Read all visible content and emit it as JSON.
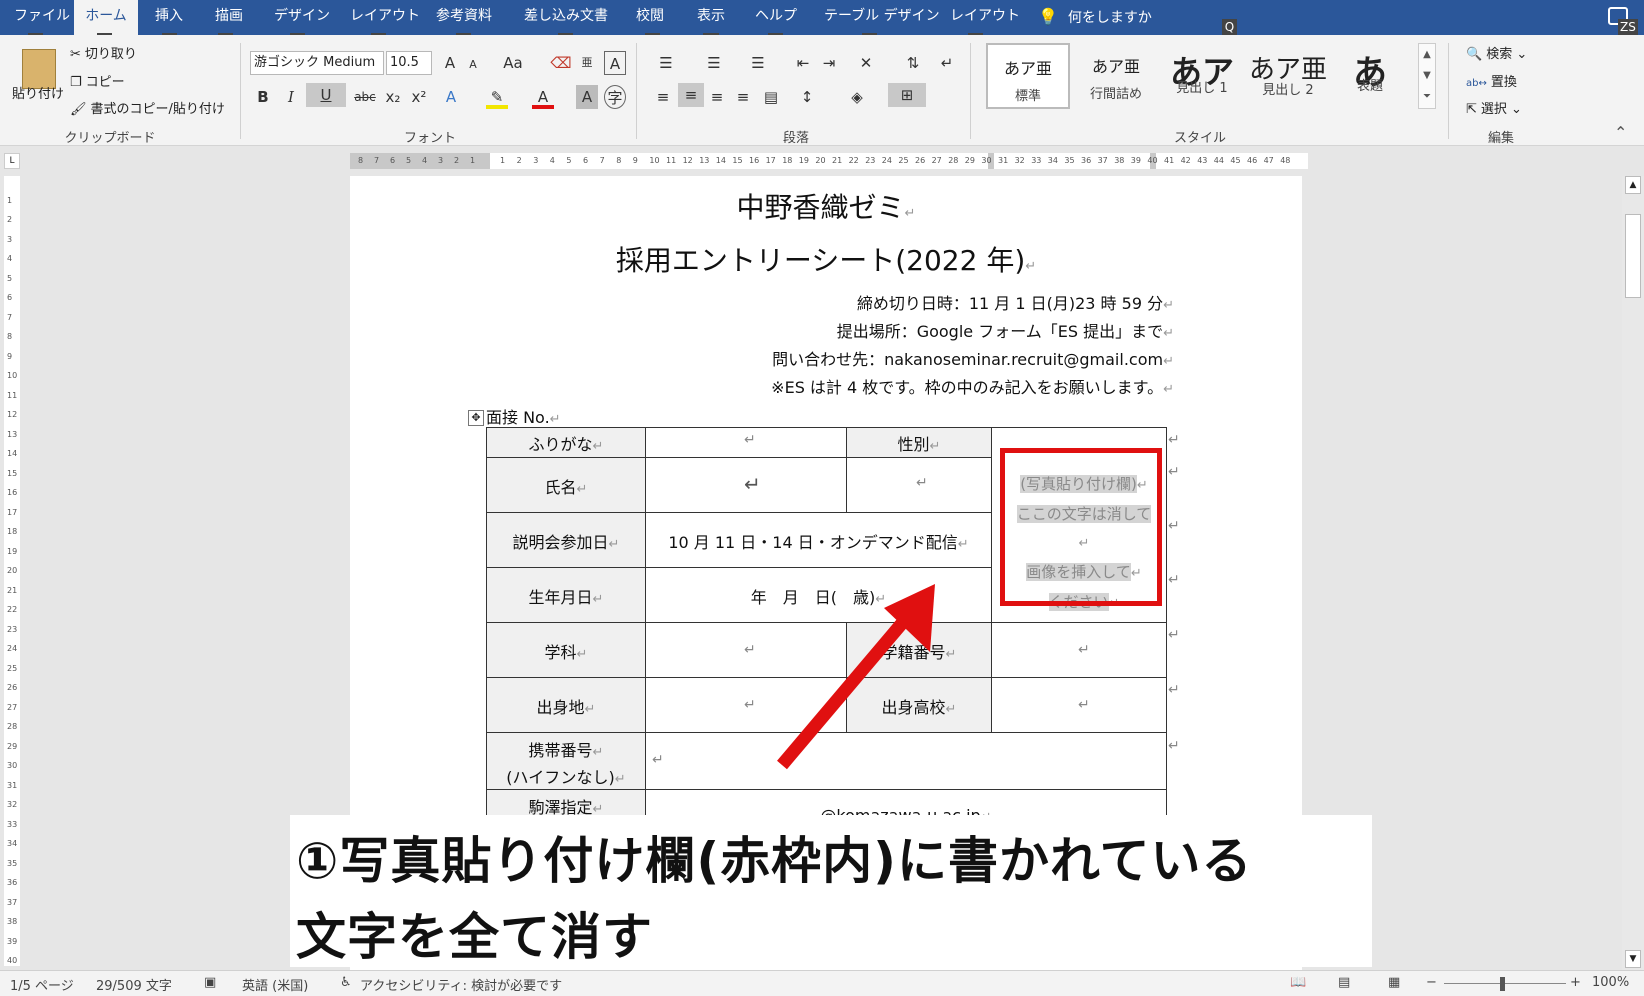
{
  "tabs": [
    {
      "label": "ファイル",
      "key": "F"
    },
    {
      "label": "ホーム",
      "key": "H",
      "active": true
    },
    {
      "label": "挿入",
      "key": "N"
    },
    {
      "label": "描画",
      "key": "JI"
    },
    {
      "label": "デザイン",
      "key": "G"
    },
    {
      "label": "レイアウト",
      "key": "P"
    },
    {
      "label": "参考資料",
      "key": "S"
    },
    {
      "label": "差し込み文書",
      "key": "M"
    },
    {
      "label": "校閲",
      "key": "R"
    },
    {
      "label": "表示",
      "key": "W"
    },
    {
      "label": "ヘルプ",
      "key": "Y"
    },
    {
      "label": "テーブル デザイン",
      "key": "JT"
    },
    {
      "label": "レイアウト",
      "key": "JL"
    }
  ],
  "tellme": {
    "label": "何をしますか",
    "key": "Q"
  },
  "user_key": "ZS",
  "clipboard": {
    "paste": "貼り付け",
    "cut": "切り取り",
    "copy": "コピー",
    "format_painter": "書式のコピー/貼り付け",
    "group": "クリップボード"
  },
  "font": {
    "name": "游ゴシック Medium",
    "size": "10.5",
    "grow": "A",
    "shrink": "A",
    "case": "Aa",
    "bold": "B",
    "italic": "I",
    "underline": "U",
    "strike": "abc",
    "sub": "x₂",
    "sup": "x²",
    "group": "フォント"
  },
  "paragraph": {
    "group": "段落"
  },
  "styles": {
    "items": [
      {
        "preview": "あア亜",
        "label": "標準"
      },
      {
        "preview": "あア亜",
        "label": "行間詰め"
      },
      {
        "preview": "あア",
        "label": "見出し 1"
      },
      {
        "preview": "あア亜",
        "label": "見出し 2"
      },
      {
        "preview": "あ",
        "label": "表題"
      }
    ],
    "group": "スタイル"
  },
  "editing": {
    "find": "検索",
    "replace": "置換",
    "select": "選択",
    "group": "編集"
  },
  "document": {
    "title1": "中野香織ゼミ",
    "title2": "採用エントリーシート(2022 年)",
    "deadline": "締め切り日時：11 月 1 日(月)23 時 59 分",
    "submit": "提出場所：Google フォーム「ES 提出」まで",
    "contact": "問い合わせ先：nakanoseminar.recruit@gmail.com",
    "note": "※ES は計 4 枚です。枠の中のみ記入をお願いします。",
    "interview_no": "面接 No."
  },
  "table": {
    "furigana": "ふりがな",
    "gender": "性別",
    "name": "氏名",
    "session": "説明会参加日",
    "session_value": "10 月 11 日・14 日・オンデマンド配信",
    "birth": "生年月日",
    "birth_value": "年　月　日(　歳)",
    "dept": "学科",
    "student_no": "学籍番号",
    "hometown": "出身地",
    "highschool": "出身高校",
    "mobile1": "携帯番号",
    "mobile2": "(ハイフンなし)",
    "komazawa": "駒澤指定",
    "komazawa_value": "@komazawa-u.ac.jp",
    "photo": [
      "(写真貼り付け欄)",
      "ここの文字は消して",
      "画像を挿入して",
      "ください"
    ]
  },
  "caption": {
    "line1": "①写真貼り付け欄(赤枠内)に書かれている",
    "line2": "文字を全て消す"
  },
  "status": {
    "page": "1/5 ページ",
    "words": "29/509 文字",
    "lang": "英語 (米国)",
    "access": "アクセシビリティ: 検討が必要です",
    "zoom": "100%"
  },
  "colors": {
    "ribbon": "#2b579a",
    "highlight": "#e01010"
  }
}
